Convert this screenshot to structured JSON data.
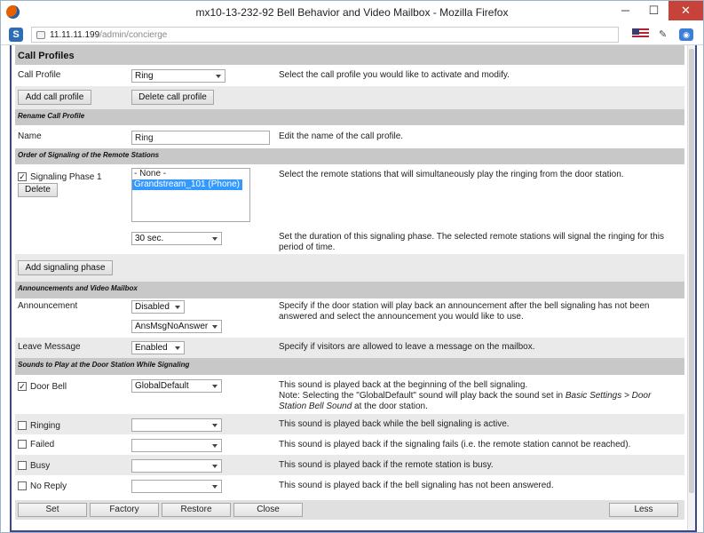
{
  "window": {
    "title": "mx10-13-232-92 Bell Behavior and Video Mailbox - Mozilla Firefox",
    "min": "─",
    "max": "☐",
    "close": "✕"
  },
  "browser": {
    "url_host": "11.11.11.199",
    "url_path": "/admin/concierge",
    "s_icon": "S"
  },
  "call_profiles": {
    "header": "Call Profiles",
    "label": "Call Profile",
    "value": "Ring",
    "description": "Select the call profile you would like to activate and modify.",
    "add_btn": "Add call profile",
    "delete_btn": "Delete call profile"
  },
  "rename": {
    "header": "Rename Call Profile",
    "label": "Name",
    "value": "Ring",
    "description": "Edit the name of the call profile."
  },
  "order": {
    "header": "Order of Signaling of the Remote Stations",
    "phase_label": "Signaling Phase 1",
    "phase_checked": "✓",
    "delete_btn": "Delete",
    "list_options": [
      "- None -",
      "Grandstream_101 (Phone)"
    ],
    "list_selected": "Grandstream_101 (Phone)",
    "description": "Select the remote stations that will simultaneously play the ringing from the door station.",
    "duration": "30 sec.",
    "duration_desc": "Set the duration of this signaling phase. The selected remote stations will signal the ringing for this period of time.",
    "add_btn": "Add signaling phase"
  },
  "announcements": {
    "header": "Announcements and Video Mailbox",
    "announcement_label": "Announcement",
    "announcement_value": "Disabled",
    "announcement_file": "AnsMsgNoAnswer",
    "announcement_desc": "Specify if the door station will play back an announcement after the bell signaling has not been answered and select the announcement you would like to use.",
    "leave_label": "Leave Message",
    "leave_value": "Enabled",
    "leave_desc": "Specify if visitors are allowed to leave a message on the mailbox."
  },
  "sounds": {
    "header": "Sounds to Play at the Door Station While Signaling",
    "door_bell": {
      "label": "Door Bell",
      "checked": "✓",
      "value": "GlobalDefault",
      "desc1": "This sound is played back at the beginning of the bell signaling.",
      "desc2a": "Note: Selecting the \"GlobalDefault\" sound will play back the sound set in ",
      "desc2b": "Basic Settings > Door Station Bell Sound",
      "desc2c": " at the door station."
    },
    "ringing": {
      "label": "Ringing",
      "checked": "",
      "value": "",
      "desc": "This sound is played back while the bell signaling is active."
    },
    "failed": {
      "label": "Failed",
      "checked": "",
      "value": "",
      "desc": "This sound is played back if the signaling fails (i.e. the remote station cannot be reached)."
    },
    "busy": {
      "label": "Busy",
      "checked": "",
      "value": "",
      "desc": "This sound is played back if the remote station is busy."
    },
    "no_reply": {
      "label": "No Reply",
      "checked": "",
      "value": "",
      "desc": "This sound is played back if the bell signaling has not been answered."
    }
  },
  "footer": {
    "set": "Set",
    "factory": "Factory",
    "restore": "Restore",
    "close": "Close",
    "less": "Less"
  }
}
